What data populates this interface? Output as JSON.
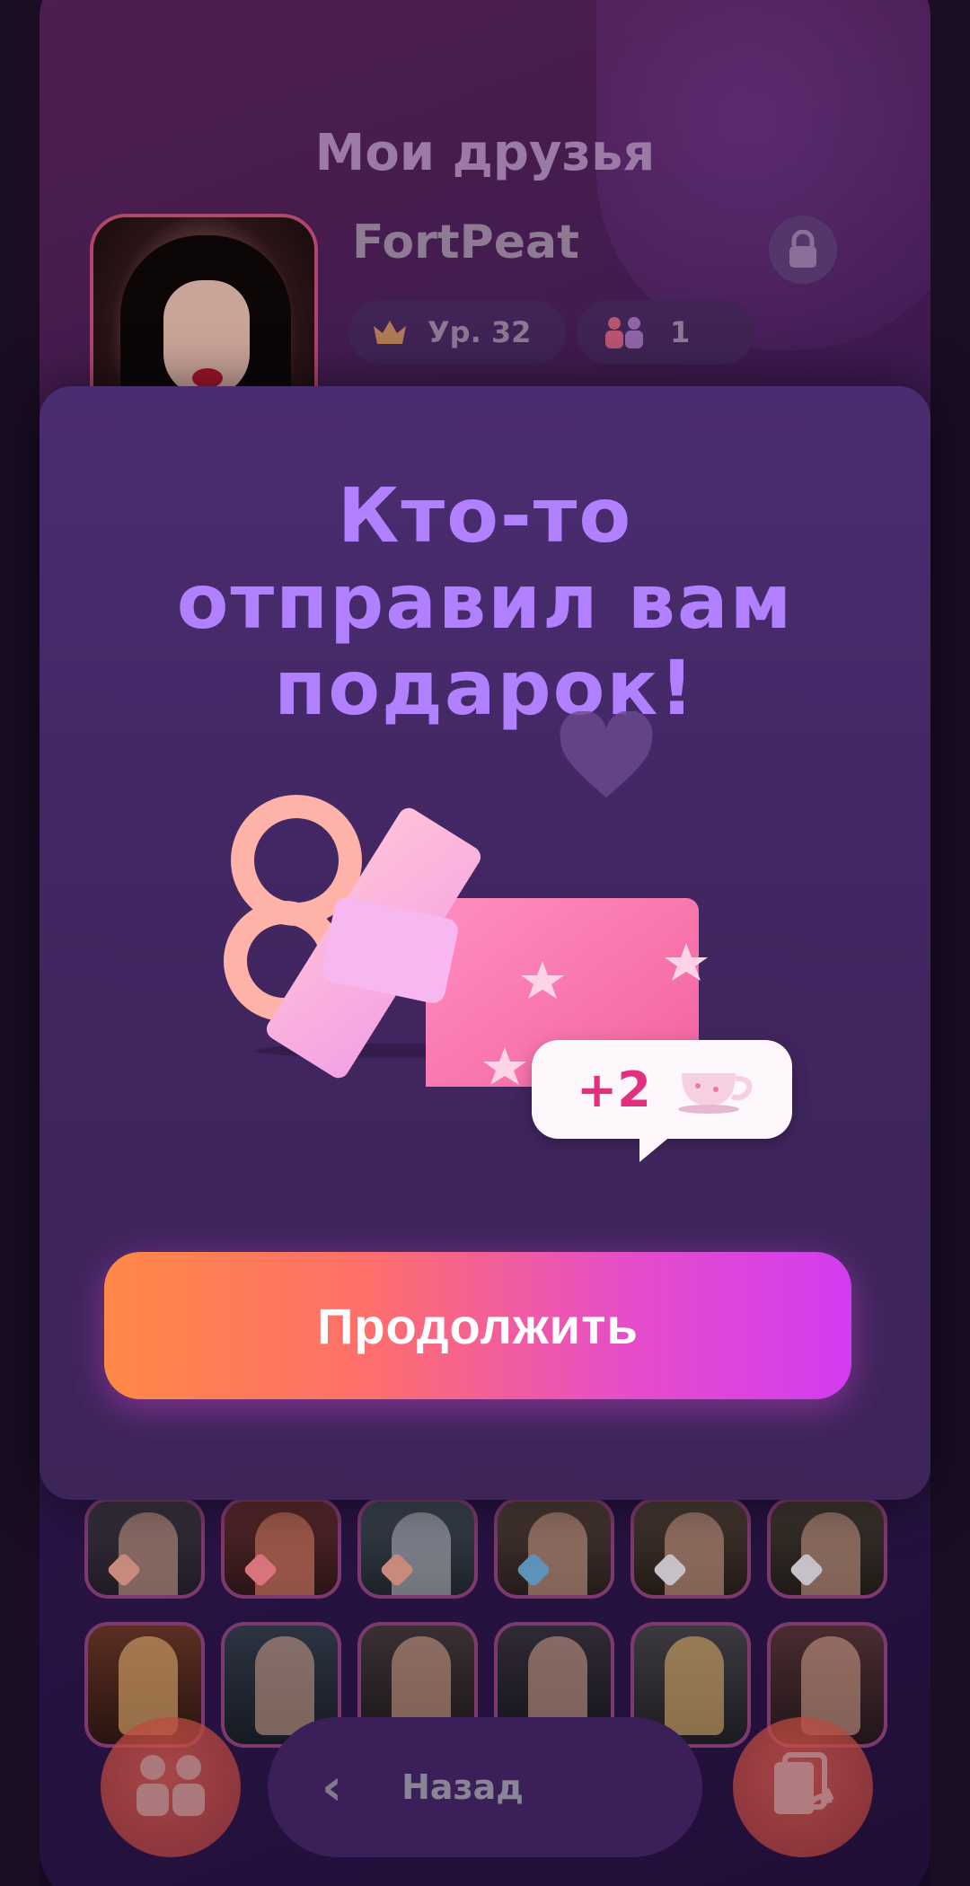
{
  "background": {
    "friends_title": "Мои друзья",
    "profile": {
      "name": "FortPeat",
      "level": "Ур. 32",
      "friends_count": "1"
    },
    "bottom_bar": {
      "back_label": "Назад",
      "left_icon": "friends-icon",
      "right_icon": "cards-exchange-icon"
    }
  },
  "modal": {
    "title_lines": [
      "Кто-то",
      "отправил вам",
      "подарок!"
    ],
    "reward": {
      "amount": "+2",
      "item_icon": "teacup-icon"
    },
    "continue_label": "Продолжить"
  },
  "colors": {
    "title": "#b080ff",
    "button_gradient_start": "#ff8846",
    "button_gradient_end": "#d23cf0",
    "reward_text": "#e3307e"
  }
}
